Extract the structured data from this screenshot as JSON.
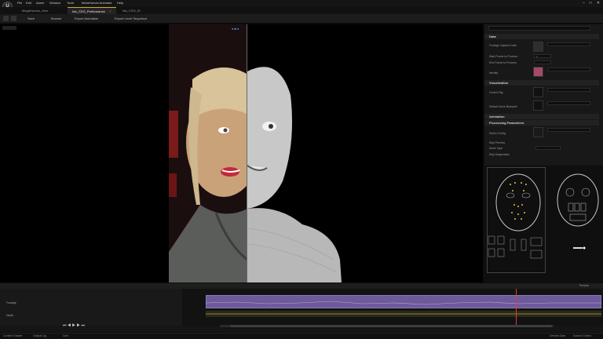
{
  "menu": {
    "items": [
      "File",
      "Edit",
      "Asset",
      "Window",
      "Tools",
      "MetaHuman Animator",
      "Help"
    ]
  },
  "tabs": [
    {
      "label": "MegaHuman_Vero"
    },
    {
      "label": "Ida_CDG_Performance"
    },
    {
      "label": "Ida_CDG_ID"
    }
  ],
  "toolbar": {
    "save_label": "Save",
    "browse_label": "Browse",
    "process_label": "Export Animation",
    "level_seq_label": "Export Level Sequence"
  },
  "details": {
    "sections": [
      "Data",
      "Visualization",
      "Animation",
      "Processing Parameters"
    ],
    "data_props": [
      {
        "label": "Footage Capture Data",
        "value": ""
      },
      {
        "label": "Start Frame to Process",
        "value": "0"
      },
      {
        "label": "End Frame to Process",
        "value": ""
      },
      {
        "label": "Identity",
        "value": ""
      }
    ],
    "vis_props": [
      {
        "label": "Control Rig",
        "value": ""
      },
      {
        "label": "Default Solve Blueprint",
        "value": ""
      }
    ],
    "proc_props": [
      {
        "label": "Solver Config",
        "value": ""
      },
      {
        "label": "Skip Preview",
        "value": ""
      },
      {
        "label": "Solve Type",
        "value": ""
      },
      {
        "label": "Skip Diagnostics",
        "value": ""
      }
    ]
  },
  "sequencer": {
    "tracks": [
      "Footage",
      "Depth"
    ],
    "header_right": "Preview"
  },
  "status": {
    "content_drawer": "Content Drawer",
    "output_log": "Output Log",
    "cmd": "Cmd",
    "source_control": "Source Control",
    "derived_data": "Derived Data"
  },
  "colors": {
    "accent": "#d9a43a",
    "clip": "#6c5a9a",
    "playhead": "#e03a3a"
  }
}
